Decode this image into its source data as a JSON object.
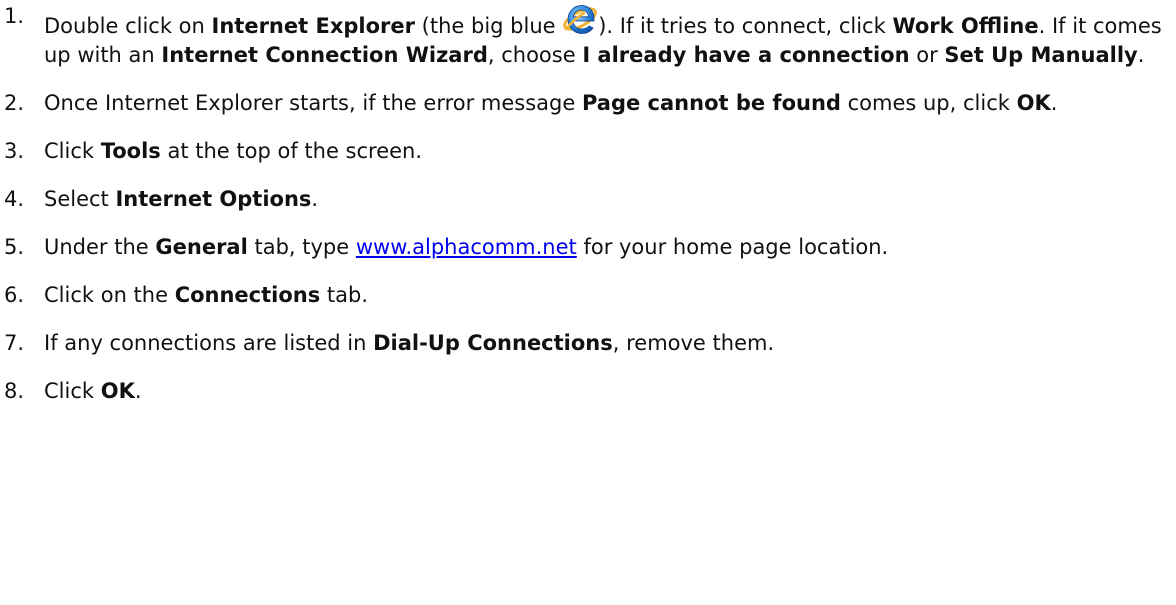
{
  "steps": [
    {
      "number": "1.",
      "t1": "Double click on ",
      "b1": "Internet Explorer",
      "t2": " (the big blue ",
      "icon": "internet-explorer-icon",
      "t3": ").  If it tries to connect, click ",
      "b2": "Work Offline",
      "t4": ". If it comes up with an ",
      "b3": "Internet Connection Wizard",
      "t5": ", choose ",
      "b4": "I already have a connection",
      "t6": " or ",
      "b5": "Set Up Manually",
      "t7": "."
    },
    {
      "number": "2.",
      "t1": "Once Internet Explorer starts, if the error message ",
      "b1": "Page cannot be found",
      "t2": " comes up, click ",
      "b2": "OK",
      "t3": "."
    },
    {
      "number": "3.",
      "t1": "Click ",
      "b1": "Tools",
      "t2": " at the top of the screen."
    },
    {
      "number": "4.",
      "t1": "Select ",
      "b1": "Internet Options",
      "t2": "."
    },
    {
      "number": "5.",
      "t1": "Under the ",
      "b1": "General",
      "t2": " tab, type ",
      "link": "www.alphacomm.net",
      "t3": " for your home page location."
    },
    {
      "number": "6.",
      "t1": "Click on the ",
      "b1": "Connections",
      "t2": " tab."
    },
    {
      "number": "7.",
      "t1": "If any connections are listed in ",
      "b1": "Dial-Up Connections",
      "t2": ", remove them."
    },
    {
      "number": "8.",
      "t1": "Click ",
      "b1": "OK",
      "t2": "."
    }
  ],
  "colors": {
    "text": "#111111",
    "link": "#0000ee",
    "icon_blue": "#1f7ad8",
    "icon_ring": "#f2b233"
  }
}
